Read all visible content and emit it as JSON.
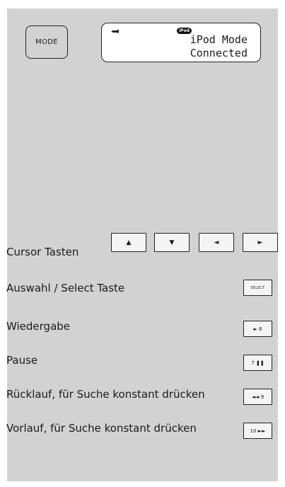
{
  "mode_button": {
    "label": "MODE"
  },
  "display": {
    "signal": "◂▪▪▮",
    "badge": "iPod",
    "line1": "iPod Mode",
    "line2": "Connected"
  },
  "controls": {
    "cursor": {
      "label": "Cursor Tasten",
      "keys": [
        "▲",
        "▼",
        "◄",
        "►"
      ]
    },
    "select": {
      "label": "Auswahl / Select Taste",
      "key": "SELECT"
    },
    "play": {
      "label": "Wiedergabe",
      "key": "► 6"
    },
    "pause": {
      "label": "Pause",
      "key": "7 ❚❚"
    },
    "rewind": {
      "label": "Rücklauf, für Suche konstant drücken",
      "key": "◄◄ 9"
    },
    "forward": {
      "label": "Vorlauf, für Suche konstant drücken",
      "key": "10 ►►"
    }
  }
}
